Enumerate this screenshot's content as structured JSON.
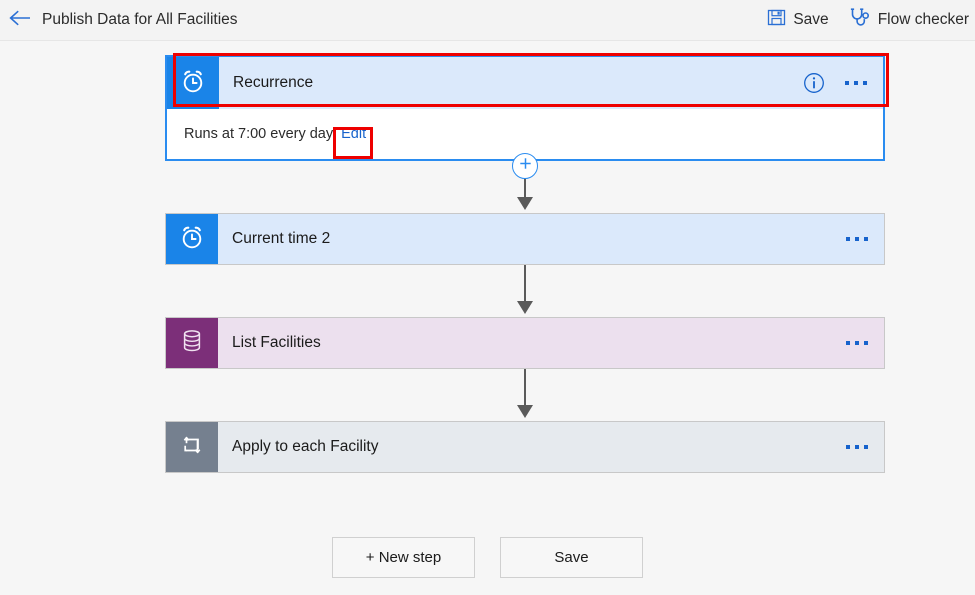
{
  "header": {
    "back_icon": "arrow-left-icon",
    "title": "Publish Data for All Facilities",
    "actions": [
      {
        "label": "Save",
        "icon": "save-floppy-icon"
      },
      {
        "label": "Flow checker",
        "icon": "stethoscope-icon"
      }
    ]
  },
  "colors": {
    "accent_blue": "#2a8cf0",
    "link_blue": "#1763cc",
    "trigger_blue": "#1a84e8",
    "trigger_bg": "#dbe9fb",
    "database_purple": "#7c2f79",
    "database_bg": "#ece0ee",
    "loop_slate": "#75808f",
    "loop_bg": "#e6eaee",
    "annotation_red": "#ee0000",
    "canvas_bg": "#f6f6f6"
  },
  "flow": {
    "trigger": {
      "title": "Recurrence",
      "icon": "alarm-clock-icon",
      "selected": true,
      "detail_text": "Runs at 7:00 every day",
      "edit_label": "Edit",
      "info_icon": "info-circle-icon",
      "menu_icon": "ellipsis-icon",
      "annotated": true
    },
    "steps": [
      {
        "title": "Current time 2",
        "icon": "alarm-clock-icon",
        "menu_icon": "ellipsis-icon",
        "kind": "trigger-blue"
      },
      {
        "title": "List Facilities",
        "icon": "database-icon",
        "menu_icon": "ellipsis-icon",
        "kind": "database-purple"
      },
      {
        "title": "Apply to each Facility",
        "icon": "loop-repeat-icon",
        "menu_icon": "ellipsis-icon",
        "kind": "loop-slate"
      }
    ],
    "connectors": [
      {
        "has_add_button": true,
        "add_icon": "plus-circle-icon"
      },
      {
        "has_add_button": false
      },
      {
        "has_add_button": false
      }
    ]
  },
  "bottom_buttons": [
    {
      "label": "+ New step"
    },
    {
      "label": "Save"
    }
  ]
}
